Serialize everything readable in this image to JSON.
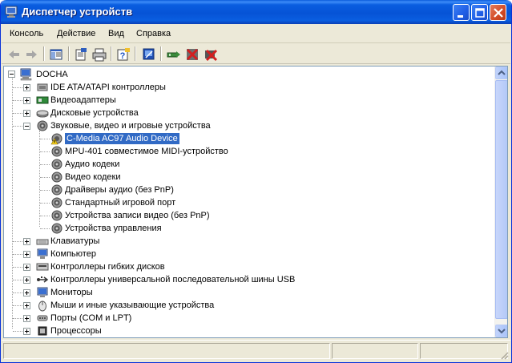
{
  "window": {
    "title": "Диспетчер устройств",
    "icon": "device-manager-icon"
  },
  "menu": {
    "items": [
      "Консоль",
      "Действие",
      "Вид",
      "Справка"
    ]
  },
  "toolbar": {
    "buttons": [
      "back-icon",
      "forward-icon",
      "show-hide-tree-icon",
      "properties-icon",
      "print-icon",
      "help-icon",
      "scan-hardware-icon",
      "update-driver-icon",
      "disable-device-icon",
      "uninstall-device-icon"
    ]
  },
  "tree": {
    "root": "DOCHA",
    "categories": [
      {
        "label": "IDE ATA/ATAPI контроллеры",
        "icon": "ide-controller-icon",
        "expanded": false
      },
      {
        "label": "Видеоадаптеры",
        "icon": "display-adapter-icon",
        "expanded": false
      },
      {
        "label": "Дисковые устройства",
        "icon": "disk-drive-icon",
        "expanded": false
      },
      {
        "label": "Звуковые, видео и игровые устройства",
        "icon": "sound-device-icon",
        "expanded": true,
        "children": [
          {
            "label": "C-Media AC97 Audio Device",
            "icon": "warning-sound-icon",
            "selected": true,
            "warning": true
          },
          {
            "label": "MPU-401 совместимое MIDI-устройство",
            "icon": "sound-device-icon"
          },
          {
            "label": "Аудио кодеки",
            "icon": "sound-device-icon"
          },
          {
            "label": "Видео кодеки",
            "icon": "sound-device-icon"
          },
          {
            "label": "Драйверы аудио (без PnP)",
            "icon": "sound-device-icon"
          },
          {
            "label": "Стандартный игровой порт",
            "icon": "sound-device-icon"
          },
          {
            "label": "Устройства записи видео (без PnP)",
            "icon": "sound-device-icon"
          },
          {
            "label": "Устройства управления",
            "icon": "sound-device-icon"
          }
        ]
      },
      {
        "label": "Клавиатуры",
        "icon": "keyboard-icon",
        "expanded": false
      },
      {
        "label": "Компьютер",
        "icon": "computer-icon",
        "expanded": false
      },
      {
        "label": "Контроллеры гибких дисков",
        "icon": "floppy-controller-icon",
        "expanded": false
      },
      {
        "label": "Контроллеры универсальной последовательной шины USB",
        "icon": "usb-icon",
        "expanded": false
      },
      {
        "label": "Мониторы",
        "icon": "monitor-icon",
        "expanded": false
      },
      {
        "label": "Мыши и иные указывающие устройства",
        "icon": "mouse-icon",
        "expanded": false
      },
      {
        "label": "Порты (COM и LPT)",
        "icon": "port-icon",
        "expanded": false
      },
      {
        "label": "Процессоры",
        "icon": "processor-icon",
        "expanded": false
      }
    ]
  },
  "colors": {
    "selection": "#316ac5",
    "titlebar": "#0a5ee0"
  }
}
